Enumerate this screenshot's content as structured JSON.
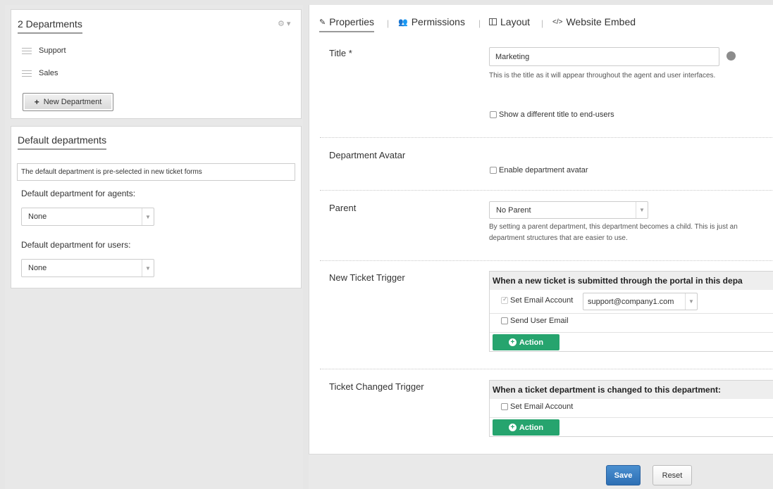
{
  "departments_panel": {
    "title": "2 Departments",
    "items": [
      {
        "label": "Support"
      },
      {
        "label": "Sales"
      }
    ],
    "new_button_label": "New Department"
  },
  "default_panel": {
    "title": "Default departments",
    "info_text": "The default department is pre-selected in new ticket forms",
    "agents_label": "Default department for agents:",
    "agents_value": "None",
    "users_label": "Default department for users:",
    "users_value": "None"
  },
  "tabs": [
    {
      "label": "Properties",
      "icon": "pencil-icon",
      "active": true
    },
    {
      "label": "Permissions",
      "icon": "users-icon"
    },
    {
      "label": "Layout",
      "icon": "layout-icon"
    },
    {
      "label": "Website Embed",
      "icon": "code-icon"
    }
  ],
  "form": {
    "title_label": "Title *",
    "title_value": "Marketing",
    "title_help": "This is the title as it will appear throughout the agent and user interfaces.",
    "different_title_label": "Show a different title to end-users",
    "avatar_label": "Department Avatar",
    "avatar_checkbox_label": "Enable department avatar",
    "parent_label": "Parent",
    "parent_value": "No Parent",
    "parent_help_line1": "By setting a parent department, this department becomes a child. This is just an",
    "parent_help_line2": "department structures that are easier to use.",
    "new_trigger_label": "New Ticket Trigger",
    "new_trigger_heading": "When a new ticket is submitted through the portal in this depa",
    "set_email_label": "Set Email Account",
    "email_value": "support@company1.com",
    "send_user_email_label": "Send User Email",
    "action_label": "Action",
    "changed_trigger_label": "Ticket Changed Trigger",
    "changed_trigger_heading": "When a ticket department is changed to this department:",
    "changed_set_email_label": "Set Email Account",
    "changed_action_label": "Action"
  },
  "footer": {
    "save_label": "Save",
    "reset_label": "Reset"
  },
  "colors": {
    "accent_green": "#26a46e",
    "save_blue": "#2d6fb4"
  }
}
